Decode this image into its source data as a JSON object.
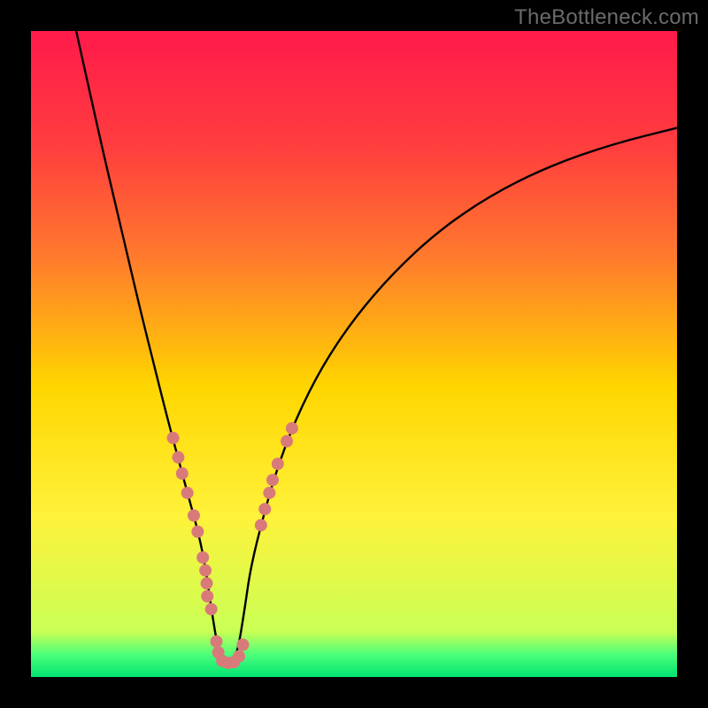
{
  "watermark": "TheBottleneck.com",
  "chart_data": {
    "type": "line",
    "title": "",
    "xlabel": "",
    "ylabel": "",
    "xlim": [
      0,
      100
    ],
    "ylim": [
      0,
      100
    ],
    "background_gradient": {
      "stops": [
        {
          "offset": 0.0,
          "color": "#ff1a4b"
        },
        {
          "offset": 0.18,
          "color": "#ff3e3e"
        },
        {
          "offset": 0.35,
          "color": "#ff7a2d"
        },
        {
          "offset": 0.55,
          "color": "#ffd600"
        },
        {
          "offset": 0.75,
          "color": "#fff23a"
        },
        {
          "offset": 0.93,
          "color": "#c9ff55"
        },
        {
          "offset": 0.965,
          "color": "#4dff7a"
        },
        {
          "offset": 1.0,
          "color": "#00e472"
        }
      ]
    },
    "series": [
      {
        "name": "bottleneck-curve",
        "x": [
          7.0,
          9.0,
          11.0,
          13.0,
          15.0,
          17.0,
          19.0,
          21.0,
          23.0,
          24.5,
          26.0,
          27.0,
          28.0,
          29.0,
          30.0,
          31.0,
          32.0,
          33.0,
          34.0,
          36.0,
          38.0,
          41.0,
          45.0,
          50.0,
          56.0,
          63.0,
          71.0,
          80.0,
          90.0,
          100.0
        ],
        "y": [
          100.0,
          91.0,
          82.0,
          73.5,
          65.0,
          56.5,
          48.5,
          40.5,
          33.0,
          27.5,
          22.0,
          17.0,
          10.0,
          4.0,
          2.0,
          2.0,
          4.0,
          10.0,
          17.0,
          25.0,
          32.0,
          40.0,
          48.0,
          55.5,
          62.5,
          69.0,
          74.5,
          79.0,
          82.5,
          85.0
        ]
      }
    ],
    "markers": {
      "name": "highlight-dots",
      "color": "#d97a7a",
      "radius": 7,
      "points": [
        {
          "x": 22.0,
          "y": 37.0
        },
        {
          "x": 22.8,
          "y": 34.0
        },
        {
          "x": 23.4,
          "y": 31.5
        },
        {
          "x": 24.2,
          "y": 28.5
        },
        {
          "x": 25.2,
          "y": 25.0
        },
        {
          "x": 25.8,
          "y": 22.5
        },
        {
          "x": 26.6,
          "y": 18.5
        },
        {
          "x": 27.0,
          "y": 16.5
        },
        {
          "x": 27.2,
          "y": 14.5
        },
        {
          "x": 27.3,
          "y": 12.5
        },
        {
          "x": 27.9,
          "y": 10.5
        },
        {
          "x": 28.7,
          "y": 5.5
        },
        {
          "x": 29.0,
          "y": 3.8
        },
        {
          "x": 29.6,
          "y": 2.5
        },
        {
          "x": 30.5,
          "y": 2.2
        },
        {
          "x": 31.4,
          "y": 2.3
        },
        {
          "x": 32.2,
          "y": 3.2
        },
        {
          "x": 32.8,
          "y": 5.0
        },
        {
          "x": 35.6,
          "y": 23.5
        },
        {
          "x": 36.2,
          "y": 26.0
        },
        {
          "x": 36.9,
          "y": 28.5
        },
        {
          "x": 37.4,
          "y": 30.5
        },
        {
          "x": 38.2,
          "y": 33.0
        },
        {
          "x": 39.6,
          "y": 36.5
        },
        {
          "x": 40.4,
          "y": 38.5
        }
      ]
    }
  }
}
